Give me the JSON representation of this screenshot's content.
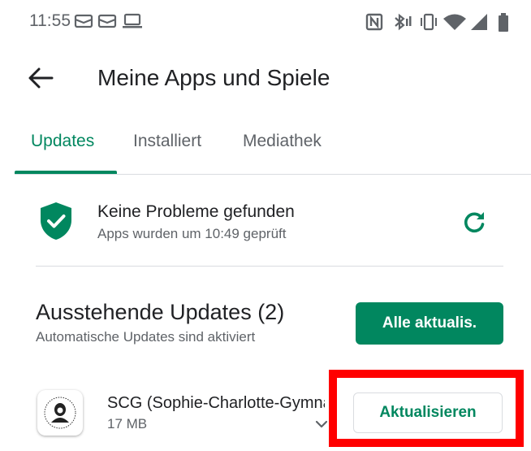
{
  "status_bar": {
    "time": "11:55",
    "notification_icons": [
      "mail-icon",
      "mail-icon",
      "laptop-icon"
    ],
    "system_icons": [
      "nfc-icon",
      "bluetooth-icon",
      "vibrate-icon",
      "wifi-icon",
      "signal-icon",
      "battery-icon"
    ]
  },
  "header": {
    "back_icon": "arrow-left-icon",
    "title": "Meine Apps und Spiele"
  },
  "tabs": [
    {
      "label": "Updates",
      "active": true
    },
    {
      "label": "Installiert",
      "active": false
    },
    {
      "label": "Mediathek",
      "active": false
    }
  ],
  "security": {
    "icon": "shield-check-icon",
    "title": "Keine Probleme gefunden",
    "subtitle": "Apps wurden um 10:49 geprüft",
    "refresh_icon": "refresh-icon"
  },
  "pending": {
    "title": "Ausstehende Updates (2)",
    "subtitle": "Automatische Updates sind aktiviert",
    "update_all_label": "Alle aktualis."
  },
  "apps": [
    {
      "name": "SCG (Sophie-Charlotte-Gymnasium)",
      "size": "17 MB",
      "action_label": "Aktualisieren"
    }
  ],
  "colors": {
    "accent": "#01875f",
    "highlight": "#ff0000",
    "text_secondary": "#5f6368"
  }
}
